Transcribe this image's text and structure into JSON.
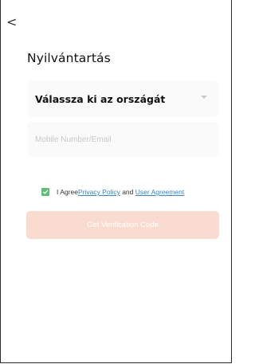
{
  "header": {
    "back_icon": "chevron-left-icon",
    "back_glyph": "<"
  },
  "title": "Nyilvántartás",
  "country_select": {
    "value": "Válassza ki az országát",
    "icon": "caret-down-icon"
  },
  "contact_input": {
    "value": "",
    "placeholder": "Mobile Number/Email"
  },
  "agreement": {
    "checked": true,
    "prefix": "I Agree",
    "privacy_link": "Privacy Policy",
    "conjunction": " and ",
    "user_agreement_link": "User Agreement"
  },
  "submit_button": {
    "label": "Get Verification Code",
    "disabled": true
  },
  "colors": {
    "checkbox": "#5dbf79",
    "link": "#3a86c8",
    "button_disabled": "#f9dbd0",
    "field_bg": "#fafafa"
  }
}
